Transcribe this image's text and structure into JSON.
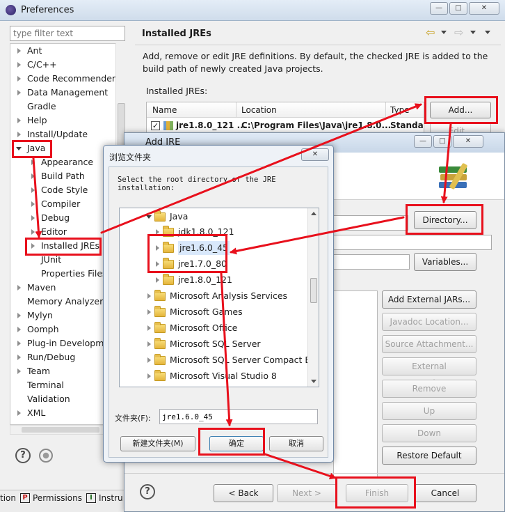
{
  "preferences": {
    "title": "Preferences",
    "filter_placeholder": "type filter text",
    "tree": [
      {
        "label": "Ant"
      },
      {
        "label": "C/C++"
      },
      {
        "label": "Code Recommenders"
      },
      {
        "label": "Data Management"
      },
      {
        "label": "Gradle"
      },
      {
        "label": "Help"
      },
      {
        "label": "Install/Update"
      },
      {
        "label": "Java"
      },
      {
        "label": "Appearance"
      },
      {
        "label": "Build Path"
      },
      {
        "label": "Code Style"
      },
      {
        "label": "Compiler"
      },
      {
        "label": "Debug"
      },
      {
        "label": "Editor"
      },
      {
        "label": "Installed JREs"
      },
      {
        "label": "JUnit"
      },
      {
        "label": "Properties Files"
      },
      {
        "label": "Maven"
      },
      {
        "label": "Memory Analyzer"
      },
      {
        "label": "Mylyn"
      },
      {
        "label": "Oomph"
      },
      {
        "label": "Plug-in Development"
      },
      {
        "label": "Run/Debug"
      },
      {
        "label": "Team"
      },
      {
        "label": "Terminal"
      },
      {
        "label": "Validation"
      },
      {
        "label": "XML"
      }
    ],
    "page_title": "Installed JREs",
    "description": "Add, remove or edit JRE definitions. By default, the checked JRE is added to the build path of newly created Java projects.",
    "installed_label": "Installed JREs:",
    "table": {
      "columns": [
        "Name",
        "Location",
        "Type"
      ],
      "row": {
        "name": "jre1.8.0_121 ...",
        "location": "C:\\Program Files\\Java\\jre1.8.0...",
        "type": "Standard..."
      }
    },
    "add_button": "Add...",
    "edit_button": "Edit..."
  },
  "add_jre": {
    "title": "Add JRE",
    "directory_button": "Directory...",
    "variables_button": "Variables...",
    "add_external_jars": "Add External JARs...",
    "javadoc_location": "Javadoc Location...",
    "source_attachment": "Source Attachment...",
    "external_annotations": "External annotations...",
    "remove": "Remove",
    "up": "Up",
    "down": "Down",
    "restore_default": "Restore Default",
    "back": "< Back",
    "next": "Next >",
    "finish": "Finish",
    "cancel": "Cancel"
  },
  "folder_dialog": {
    "title": "浏览文件夹",
    "prompt": "Select the root directory of the JRE installation:",
    "tree": [
      {
        "label": "Java"
      },
      {
        "label": "jdk1.8.0_121"
      },
      {
        "label": "jre1.6.0_45"
      },
      {
        "label": "jre1.7.0_80"
      },
      {
        "label": "jre1.8.0_121"
      },
      {
        "label": "Microsoft Analysis Services"
      },
      {
        "label": "Microsoft Games"
      },
      {
        "label": "Microsoft Office"
      },
      {
        "label": "Microsoft SQL Server"
      },
      {
        "label": "Microsoft SQL Server Compact Edition"
      },
      {
        "label": "Microsoft Visual Studio 8"
      }
    ],
    "folder_label": "文件夹(F):",
    "folder_value": "jre1.6.0_45",
    "new_folder": "新建文件夹(M)",
    "ok": "确定",
    "cancel": "取消"
  },
  "bottom_tabs": [
    {
      "label": "tion"
    },
    {
      "label": "Permissions"
    },
    {
      "label": "Instru"
    }
  ],
  "colors": {
    "highlight_red": "#e8101c",
    "window_bg": "#f0f0f0",
    "title_bg": "#dbe6f3"
  }
}
